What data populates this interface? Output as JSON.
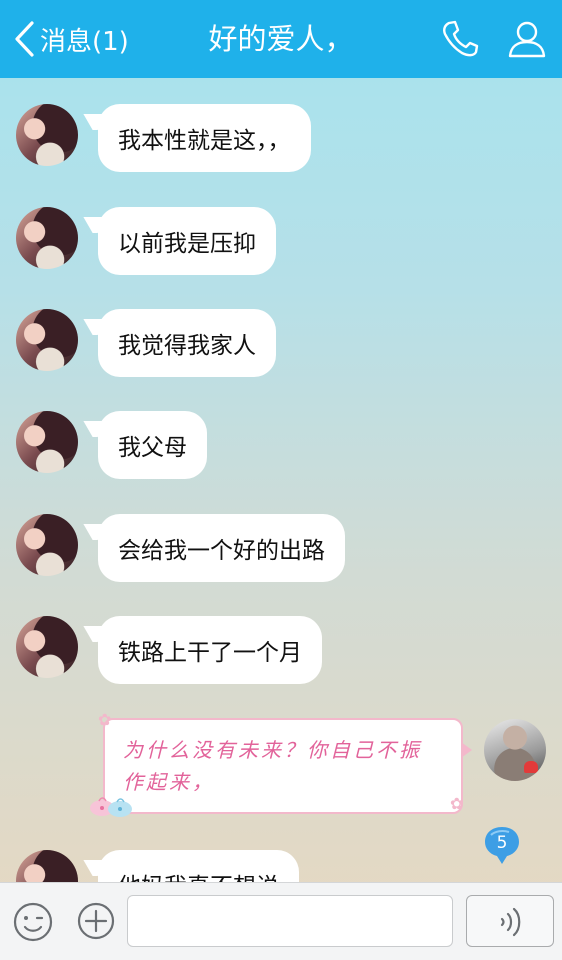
{
  "header": {
    "back_label": "消息(1)",
    "title": "好的爱人，",
    "back_icon": "chevron-left-icon",
    "call_icon": "phone-icon",
    "profile_icon": "user-icon"
  },
  "messages": [
    {
      "direction": "incoming",
      "text": "我本性就是这，，"
    },
    {
      "direction": "incoming",
      "text": "以前我是压抑"
    },
    {
      "direction": "incoming",
      "text": "我觉得我家人"
    },
    {
      "direction": "incoming",
      "text": "我父母"
    },
    {
      "direction": "incoming",
      "text": "会给我一个好的出路"
    },
    {
      "direction": "incoming",
      "text": "铁路上干了一个月"
    },
    {
      "direction": "outgoing",
      "line1": "为什么没有未来？你自己不振",
      "line2": "作起来，"
    },
    {
      "direction": "incoming",
      "text": "他妈我真不想说"
    }
  ],
  "unread_badge": "5",
  "input_bar": {
    "emoji_icon": "emoji-smile-icon",
    "plus_icon": "plus-circle-icon",
    "message_value": "",
    "voice_icon": "voice-wave-icon"
  },
  "colors": {
    "header_bg": "#1fb1ea",
    "outgoing_text": "#e2639a",
    "outgoing_border": "#f3b8cb",
    "badge": "#3d9ee5"
  }
}
